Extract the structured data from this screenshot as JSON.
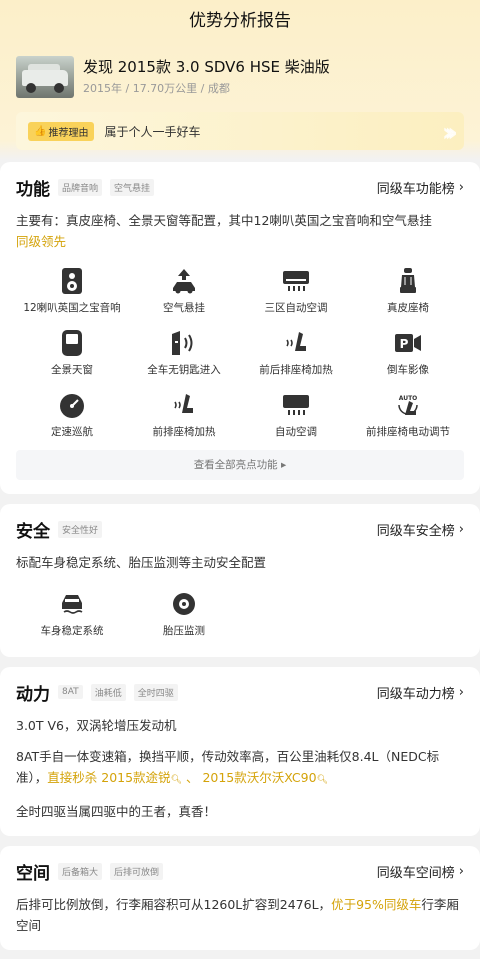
{
  "header": {
    "title": "优势分析报告"
  },
  "car": {
    "name": "发现 2015款 3.0 SDV6 HSE 柴油版",
    "meta": "2015年 / 17.70万公里 / 成都"
  },
  "reason": {
    "tag": "推荐理由",
    "text": "属于个人一手好车"
  },
  "function": {
    "title": "功能",
    "tags": [
      "品牌音响",
      "空气悬挂"
    ],
    "rank_link": "同级车功能榜",
    "desc_main": "主要有：真皮座椅、全景天窗等配置，其中12喇叭英国之宝音响和空气悬挂",
    "desc_highlight": "同级领先",
    "features": [
      {
        "label": "12喇叭英国之宝音响",
        "icon": "speaker-icon"
      },
      {
        "label": "空气悬挂",
        "icon": "air-suspension-icon"
      },
      {
        "label": "三区自动空调",
        "icon": "air-conditioner-icon"
      },
      {
        "label": "真皮座椅",
        "icon": "leather-seat-icon"
      },
      {
        "label": "全景天窗",
        "icon": "sunroof-icon"
      },
      {
        "label": "全车无钥匙进入",
        "icon": "keyless-entry-icon"
      },
      {
        "label": "前后排座椅加热",
        "icon": "seat-heating-icon"
      },
      {
        "label": "倒车影像",
        "icon": "reverse-camera-icon"
      },
      {
        "label": "定速巡航",
        "icon": "cruise-control-icon"
      },
      {
        "label": "前排座椅加热",
        "icon": "front-seat-heating-icon"
      },
      {
        "label": "自动空调",
        "icon": "auto-ac-icon"
      },
      {
        "label": "前排座椅电动调节",
        "icon": "power-seat-icon"
      }
    ],
    "view_all": "查看全部亮点功能 ▸"
  },
  "safety": {
    "title": "安全",
    "tags": [
      "安全性好"
    ],
    "rank_link": "同级车安全榜",
    "desc": "标配车身稳定系统、胎压监测等主动安全配置",
    "features": [
      {
        "label": "车身稳定系统",
        "icon": "stability-control-icon"
      },
      {
        "label": "胎压监测",
        "icon": "tire-pressure-icon"
      }
    ]
  },
  "power": {
    "title": "动力",
    "tags": [
      "8AT",
      "油耗低",
      "全时四驱"
    ],
    "rank_link": "同级车动力榜",
    "p1": "3.0T V6，双涡轮增压发动机",
    "p2_main": "8AT手自一体变速箱，换挡平顺，传动效率高，百公里油耗仅8.4L（NEDC标准），",
    "p2_link_prefix": "直接秒杀 ",
    "p2_link1": "2015款途锐",
    "p2_sep": " 、 ",
    "p2_link2": "2015款沃尔沃XC90",
    "p3": "全时四驱当属四驱中的王者，真香！"
  },
  "space": {
    "title": "空间",
    "tags": [
      "后备箱大",
      "后排可放倒"
    ],
    "rank_link": "同级车空间榜",
    "desc_main": "后排可比例放倒，行李厢容积可从1260L扩容到2476L，",
    "desc_highlight": "优于95%同级车",
    "desc_tail": "行李厢空间"
  },
  "colors": {
    "accent": "#d4a30a",
    "tag_bg": "#f9d25a"
  }
}
